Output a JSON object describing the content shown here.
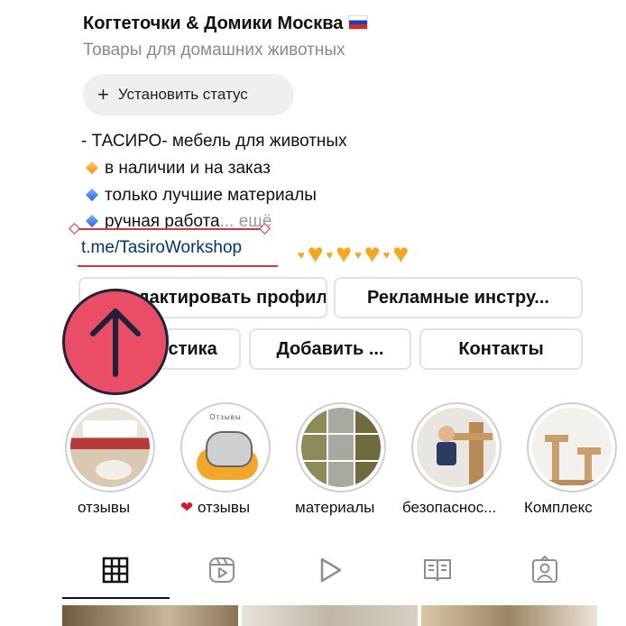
{
  "profile": {
    "name": "Когтеточки & Домики Москва",
    "category": "Товары для домашних животных",
    "status_button": "Установить статус",
    "bio": [
      "- ТАСИРО- мебель для животных",
      "в наличии и на заказ",
      "только лучшие материалы",
      "ручная работа"
    ],
    "bio_more": "... ещё",
    "link": "t.me/TasiroWorkshop"
  },
  "buttons": {
    "edit_profile": "Редактировать профиль",
    "ad_tools": "Рекламные инстру...",
    "statistics": "Статистика",
    "add": "Добавить ...",
    "contacts": "Контакты"
  },
  "highlights": [
    {
      "label": "отзывы",
      "icon": "review-screenshot"
    },
    {
      "label": "отзывы",
      "prefix": "❤️",
      "cover_text": "Отзывы",
      "icon": "pusheen-cat"
    },
    {
      "label": "материалы",
      "icon": "materials-grid"
    },
    {
      "label": "безопаснос...",
      "icon": "child-with-cat-tree"
    },
    {
      "label": "Комплекс",
      "icon": "cat-tree-set"
    }
  ],
  "tabs": [
    {
      "name": "grid-icon",
      "active": true
    },
    {
      "name": "reels-icon",
      "active": false
    },
    {
      "name": "play-icon",
      "active": false
    },
    {
      "name": "guide-icon",
      "active": false
    },
    {
      "name": "tagged-icon",
      "active": false
    }
  ],
  "colors": {
    "link": "#00376b",
    "annotation_red": "#e0323b",
    "arrow_circle": "#e94e66",
    "heart": "#f4a820"
  }
}
